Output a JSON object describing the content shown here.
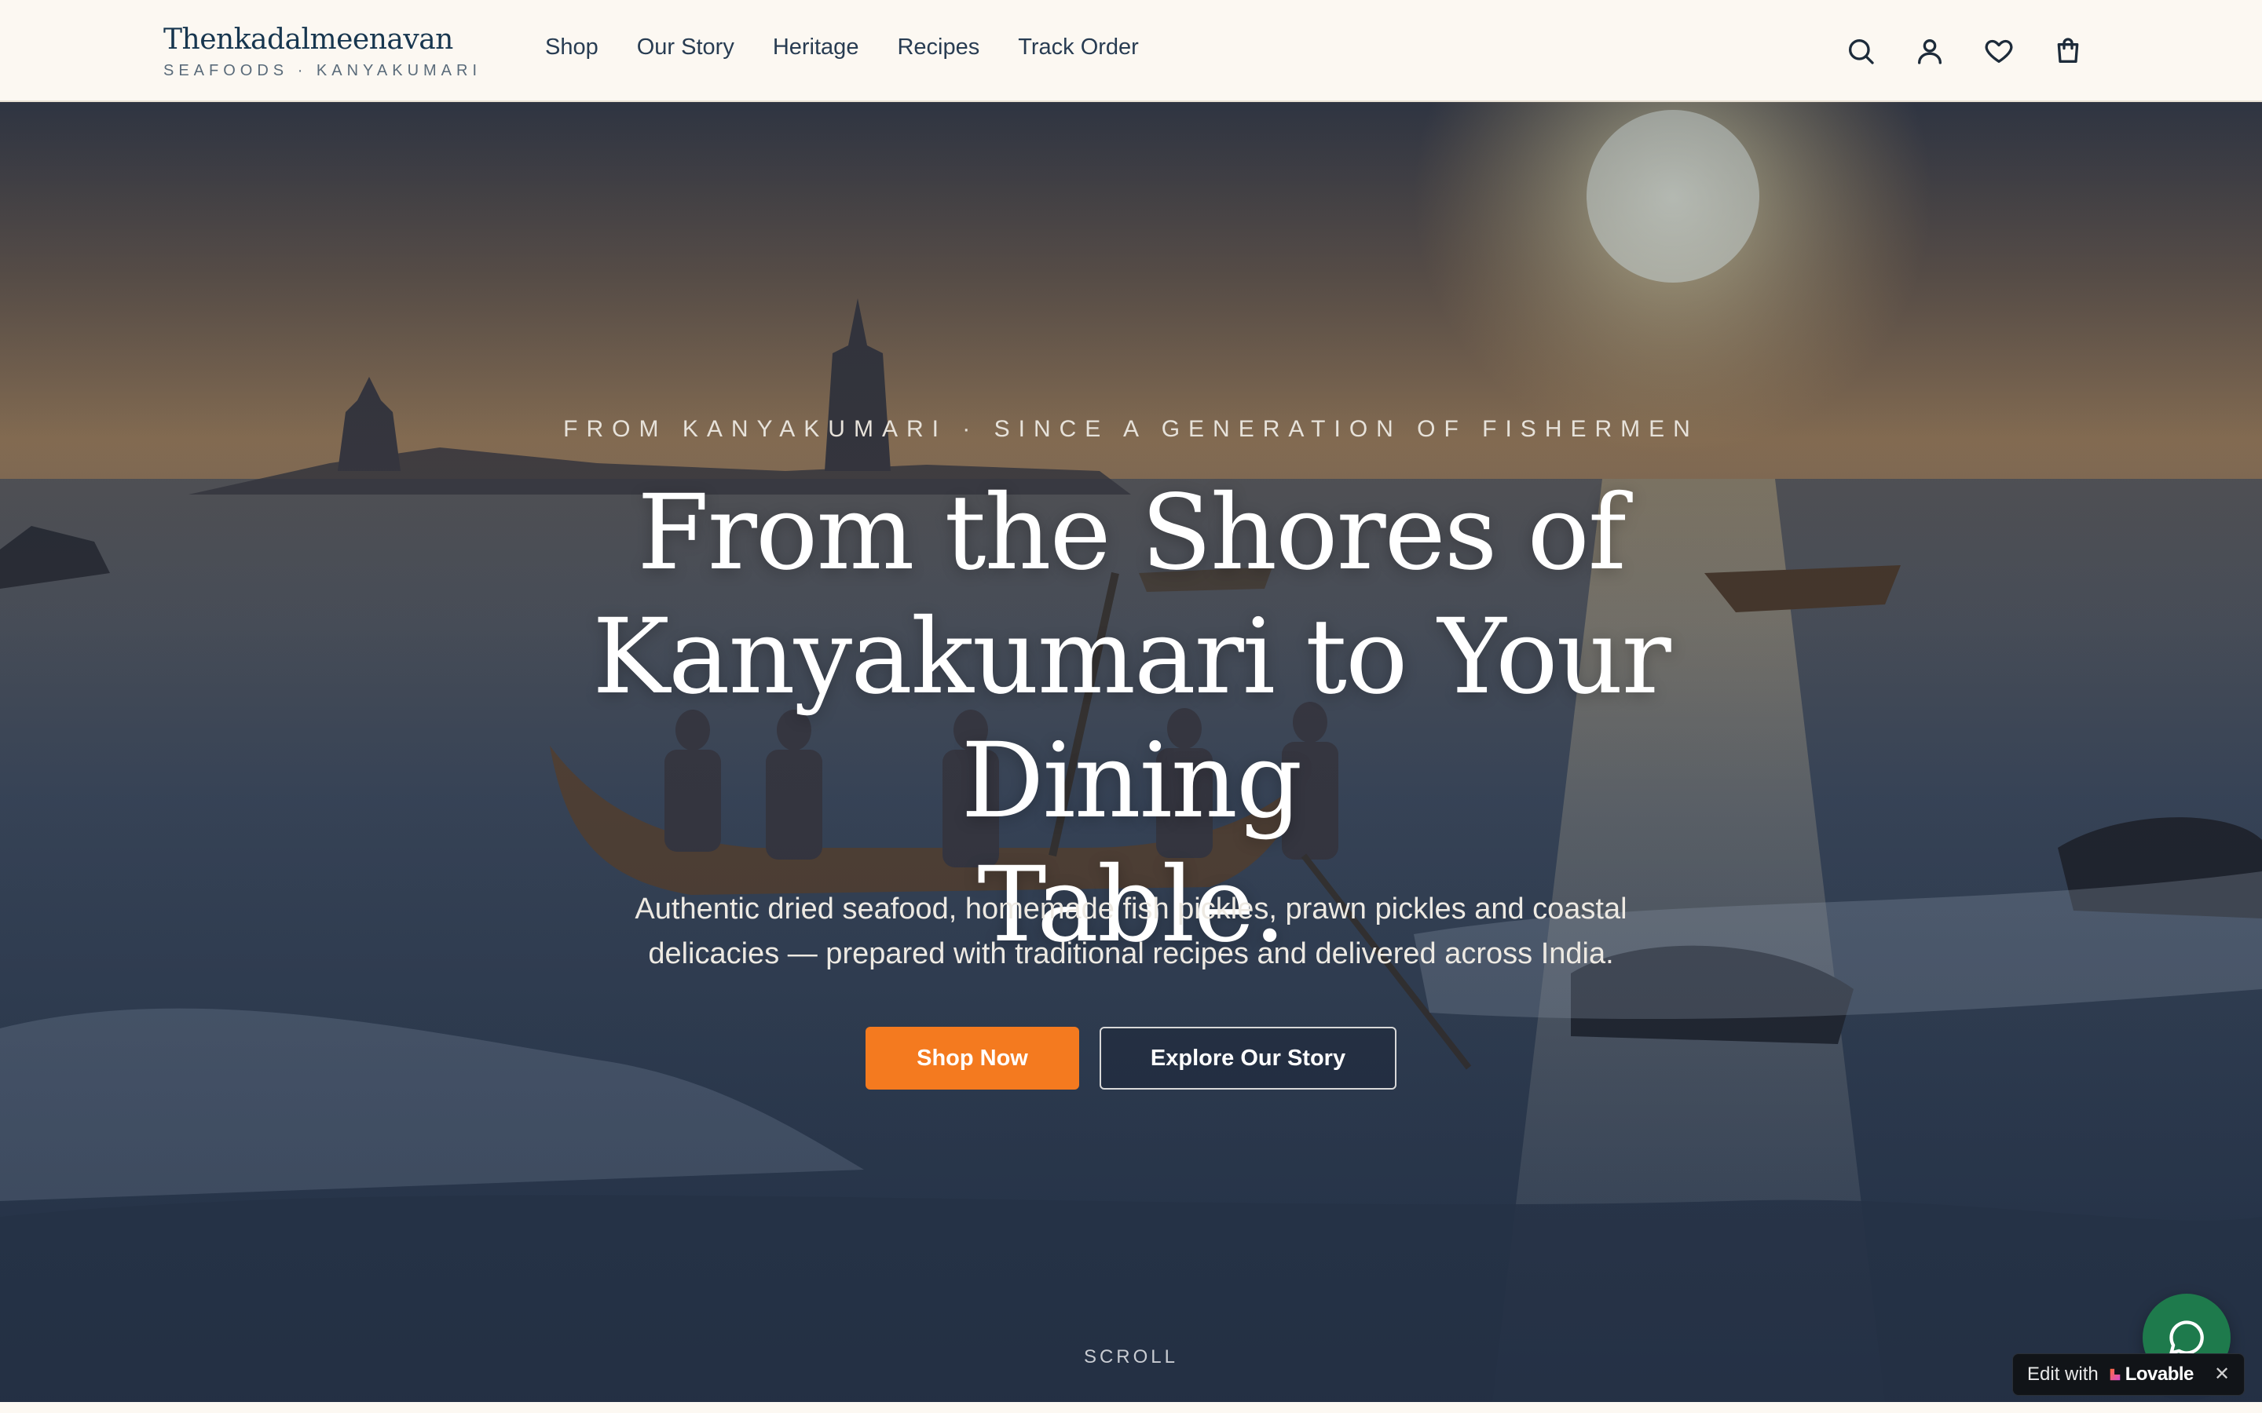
{
  "header": {
    "brand_name": "Thenkadalmeenavan",
    "brand_tagline": "SEAFOODS · KANYAKUMARI",
    "nav": [
      {
        "label": "Shop"
      },
      {
        "label": "Our Story"
      },
      {
        "label": "Heritage"
      },
      {
        "label": "Recipes"
      },
      {
        "label": "Track Order"
      }
    ],
    "icons": [
      "search-icon",
      "account-icon",
      "wishlist-heart-icon",
      "shopping-bag-icon"
    ]
  },
  "hero": {
    "eyebrow": "FROM KANYAKUMARI · SINCE A GENERATION OF FISHERMEN",
    "headline_line1": "From the Shores of",
    "headline_line2": "Kanyakumari to Your Dining",
    "headline_line3": "Table.",
    "subline_line1": "Authentic dried seafood, homemade fish pickles, prawn pickles and coastal",
    "subline_line2": "delicacies — prepared with traditional recipes and delivered across India.",
    "primary_cta": "Shop Now",
    "secondary_cta": "Explore Our Story",
    "scroll_label": "SCROLL"
  },
  "widgets": {
    "chat_icon": "chat-bubble-icon",
    "badge_prefix": "Edit with",
    "badge_brand": "Lovable",
    "badge_close": "✕"
  },
  "colors": {
    "header_bg": "#fcf8f2",
    "brand": "#17364f",
    "primary_cta": "#f47a1f",
    "chat_fab": "#1e7a4c"
  }
}
